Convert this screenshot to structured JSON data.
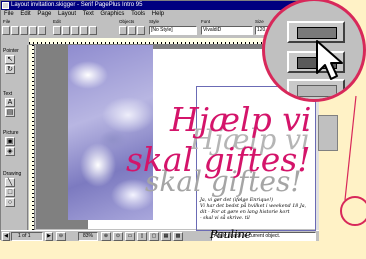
{
  "window": {
    "title": "Layout invitation.skigger - Serif PagePlus Intro 95",
    "menu": [
      "File",
      "Edit",
      "Page",
      "Layout",
      "Text",
      "Graphics",
      "Tools",
      "Help"
    ]
  },
  "toolbar": {
    "group_labels": {
      "file": "File",
      "edit": "Edit",
      "objects": "Objects",
      "style": "Style",
      "font": "Font",
      "size": "Size"
    },
    "style_value": "[No Style]",
    "font_value": "VivaldiD",
    "size_value": "120.0"
  },
  "palette": {
    "labels": {
      "pointer": "Pointer",
      "text": "Text",
      "picture": "Picture",
      "drawing": "Drawing"
    }
  },
  "document": {
    "title_line1": "Hjælp vi",
    "title_line2": "skal giftes!",
    "shadow_line1": "Hjælp vi",
    "shadow_line2": "skal giftes!",
    "body_lines": [
      "Ja, vi gør det (ifølge Enrique!)",
      "Vi har det bedst på hvilket i weekend 18 Ja,",
      "dit - For at gøre en lang historie kort",
      "- skal vi så skrive. til"
    ],
    "signature": "Pauline"
  },
  "statusbar": {
    "page_indicator": "1 of 1",
    "zoom": "83%",
    "message": "Apply shade to current object."
  },
  "icons": {
    "callout": "shade-button-magnified",
    "cursor": "arrow-cursor-icon"
  },
  "colors": {
    "titlebar": "#000080",
    "accent": "#d4146a",
    "callout_ring": "#d8285a",
    "background": "#fff2c6"
  }
}
